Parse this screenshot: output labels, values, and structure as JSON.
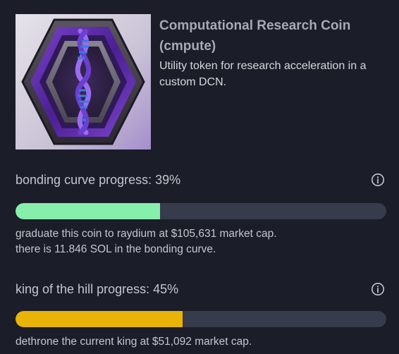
{
  "coin": {
    "name": "Computational Research Coin (cmpute)",
    "description": "Utility token for research acceleration in a custom DCN.",
    "image_icon": "dna-hexagon-logo"
  },
  "bonding_curve": {
    "label": "bonding curve progress: 39%",
    "progress_fraction": 0.39,
    "bar_color": "#86efac",
    "line1": "graduate this coin to raydium at $105,631 market cap.",
    "line2": "there is 11.846 SOL in the bonding curve.",
    "info_icon": "info-icon"
  },
  "king_of_the_hill": {
    "label": "king of the hill progress: 45%",
    "progress_fraction": 0.45,
    "bar_color": "#eab308",
    "line1": "dethrone the current king at $51,092 market cap.",
    "info_icon": "info-icon"
  },
  "colors": {
    "background": "#1b1d28",
    "track": "#363c4b"
  }
}
